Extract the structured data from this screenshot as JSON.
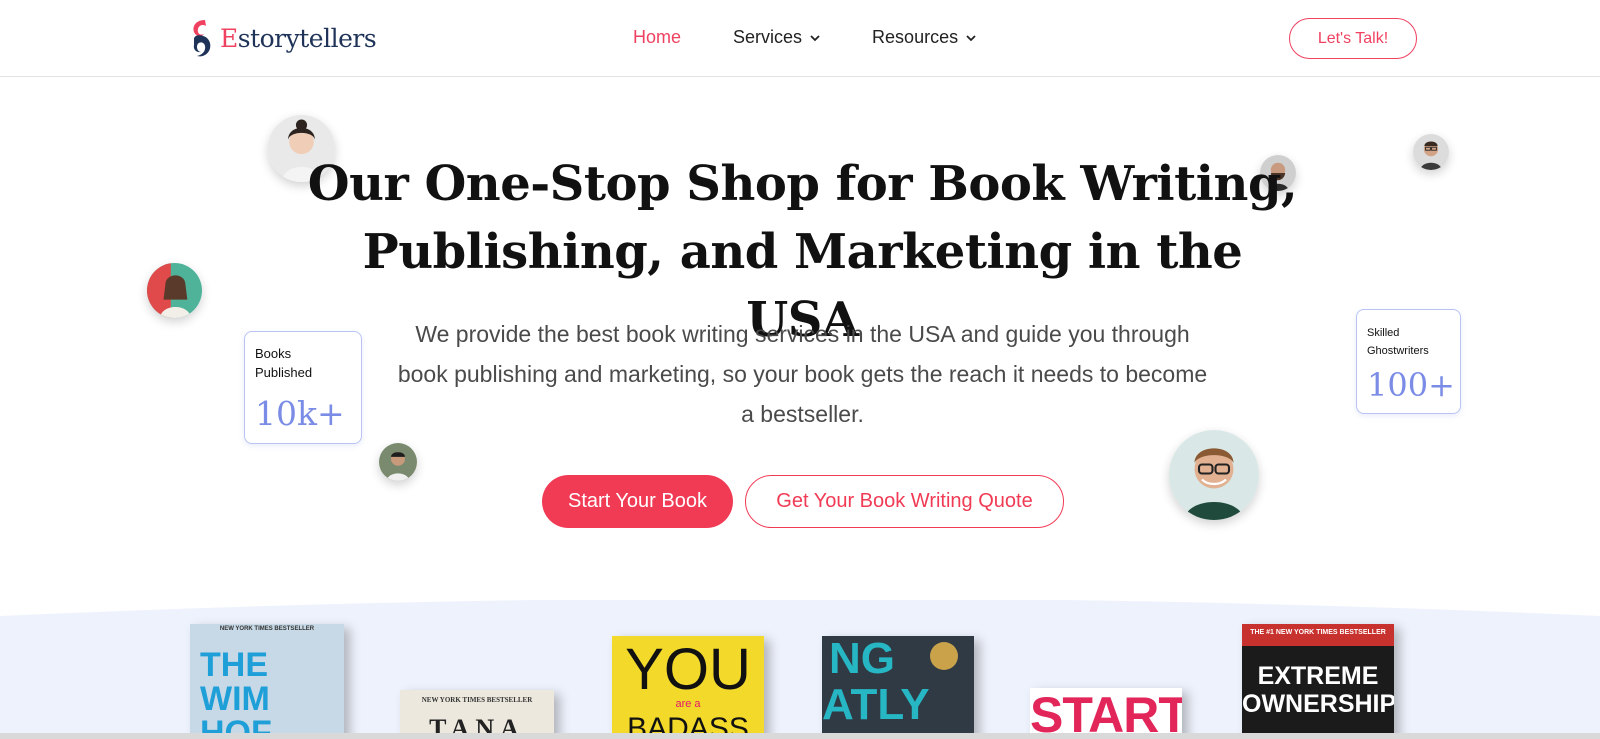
{
  "brand": {
    "name_prefix": "E",
    "name_rest": "storytellers",
    "accent_color": "#ef4160",
    "navy_color": "#1f3358"
  },
  "nav": {
    "items": [
      {
        "label": "Home",
        "active": true,
        "has_dropdown": false
      },
      {
        "label": "Services",
        "active": false,
        "has_dropdown": true
      },
      {
        "label": "Resources",
        "active": false,
        "has_dropdown": true
      }
    ],
    "cta_label": "Let's Talk!"
  },
  "hero": {
    "headline_line1": "Our One-Stop Shop for Book Writing,",
    "headline_line2": "Publishing, and Marketing in the USA",
    "subtext": "We provide the best book writing services in the USA and guide you through book publishing and marketing, so your book gets the reach it needs to become a bestseller.",
    "primary_button": "Start Your Book",
    "secondary_button": "Get Your Book Writing Quote"
  },
  "stats": {
    "left": {
      "label_line1": "Books",
      "label_line2": "Published",
      "value": "10k+"
    },
    "right": {
      "label_line1": "Skilled",
      "label_line2": "Ghostwriters",
      "value": "100+"
    }
  },
  "books": [
    {
      "top_text": "NEW YORK TIMES BESTSELLER",
      "main_text": "THE WIM HOF",
      "color": "#b9d1e2"
    },
    {
      "top_text": "NEW YORK TIMES BESTSELLER",
      "main_text": "TANA",
      "color": "#e8e4da"
    },
    {
      "top_text": "",
      "main_text": "YOU",
      "sub_text": "are a",
      "bottom_text": "BADASS",
      "color": "#f2d92a"
    },
    {
      "top_text": "",
      "main_text": "NG ATLY",
      "color": "#2f3a44"
    },
    {
      "top_text": "",
      "main_text": "START",
      "color": "#ffffff"
    },
    {
      "top_text": "THE #1 NEW YORK TIMES BESTSELLER",
      "main_text": "EXTREME OWNERSHIP",
      "color": "#1b1b1b"
    }
  ]
}
